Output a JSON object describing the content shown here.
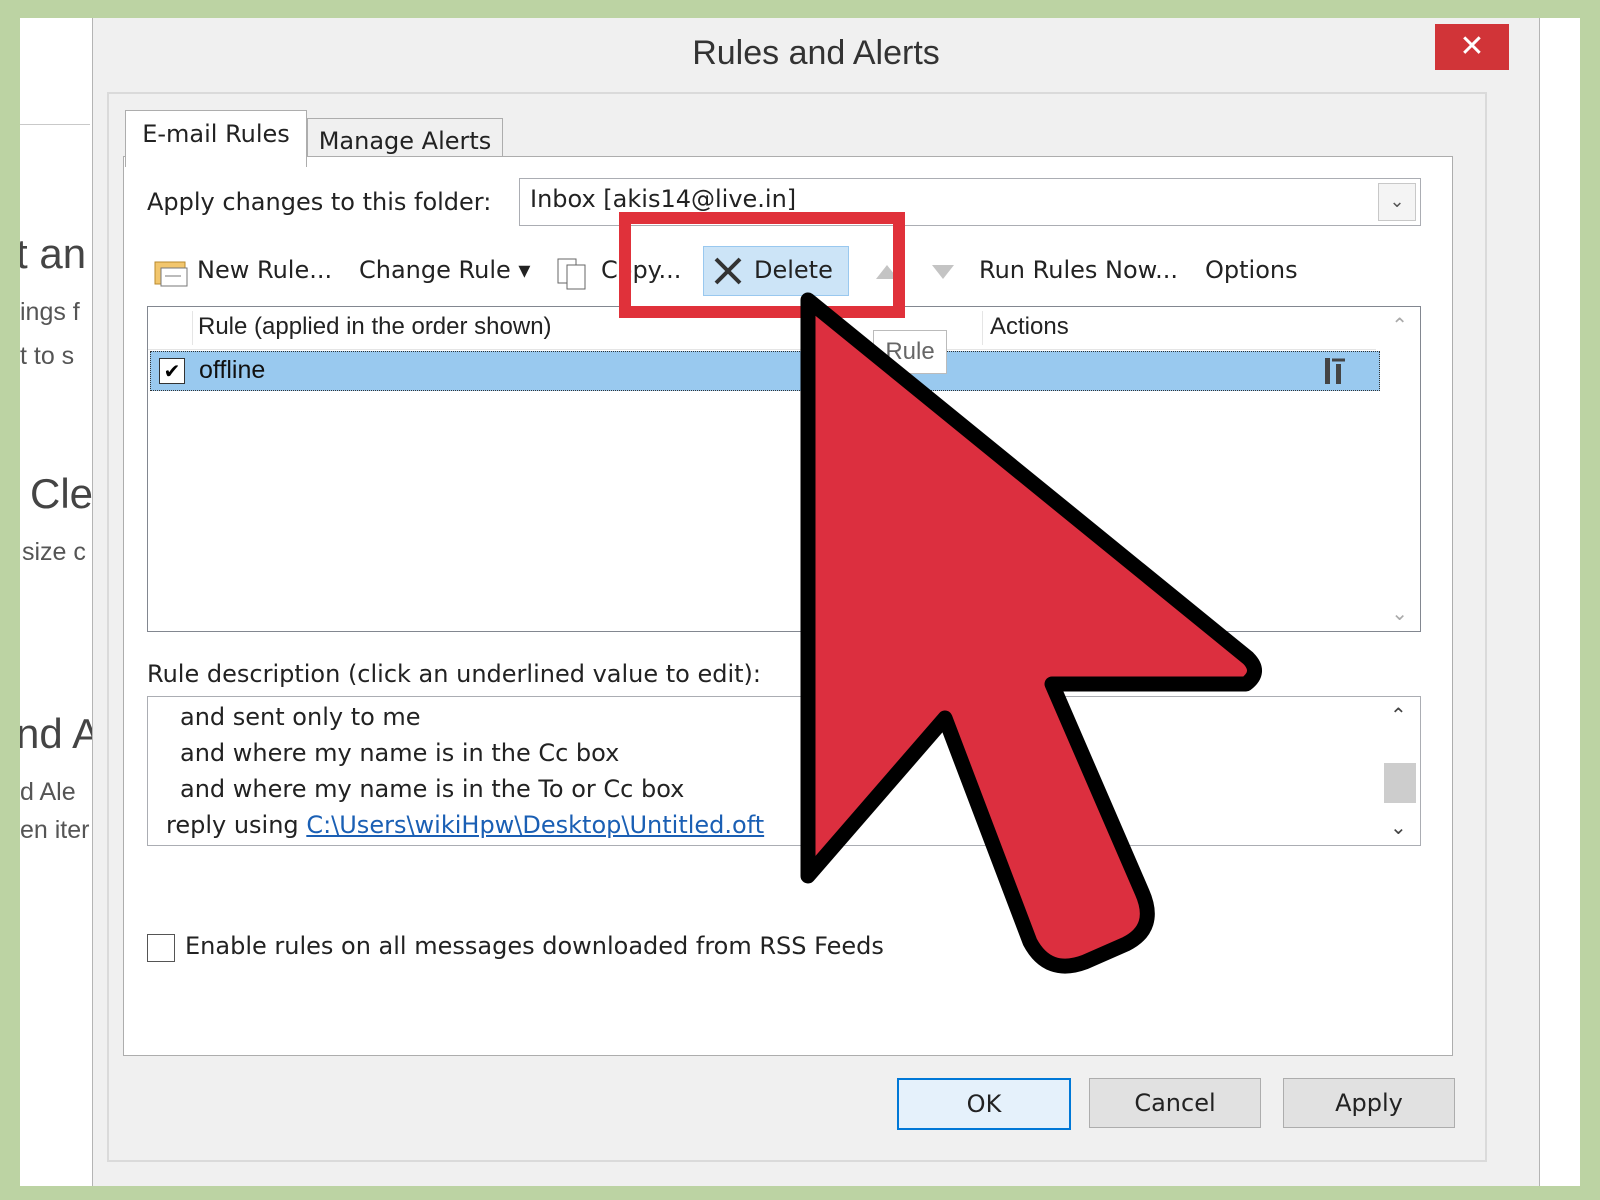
{
  "background_page": {
    "lines": [
      "t an",
      "ings f",
      "t to s",
      "Cle",
      "size c",
      "nd A",
      "d Ale",
      "en iter"
    ]
  },
  "dialog": {
    "title": "Rules and Alerts",
    "close_glyph": "✕",
    "tabs": [
      {
        "label": "E-mail Rules",
        "active": true
      },
      {
        "label": "Manage Alerts",
        "active": false
      }
    ],
    "folder_label": "Apply changes to this folder:",
    "folder_value": "Inbox [akis14@live.in]",
    "toolbar": {
      "new_rule": "New Rule...",
      "change_rule": "Change Rule ▾",
      "copy": "Copy...",
      "delete": "Delete",
      "run_rules_now": "Run Rules Now...",
      "options": "Options"
    },
    "rules_list": {
      "columns": [
        "Rule (applied in the order shown)",
        "Actions"
      ],
      "rows": [
        {
          "name": "offline",
          "checked": true,
          "selected": true
        }
      ]
    },
    "tooltip": "Rule",
    "description_label": "Rule description (click an underlined value to edit):",
    "description_lines": [
      "and sent only to me",
      "and where my name is in the Cc box",
      "and where my name is in the To or Cc box"
    ],
    "description_reply_prefix": "reply using",
    "description_reply_link": "C:\\Users\\wikiHpw\\Desktop\\Untitled.oft",
    "rss_checkbox_label": "Enable rules on all messages downloaded from RSS Feeds",
    "rss_checked": false,
    "buttons": {
      "ok": "OK",
      "cancel": "Cancel",
      "apply": "Apply"
    }
  },
  "colors": {
    "highlight": "#e0313a",
    "cursor_fill": "#dc2f3f",
    "selection": "#99c9ef",
    "close_button": "#d13438",
    "outer_frame": "#bcd3a3"
  }
}
